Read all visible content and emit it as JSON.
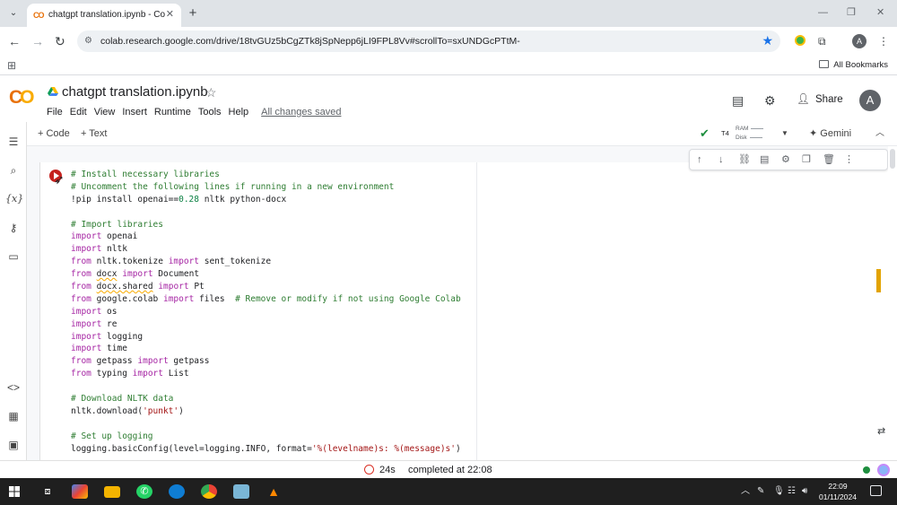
{
  "browser": {
    "tab": {
      "title": "chatgpt translation.ipynb - Cola",
      "favicon": "CO"
    },
    "url": "colab.research.google.com/drive/18tvGUz5bCgZTk8jSpNepp6jLI9FPL8Vv#scrollTo=sxUNDGcPTtM-",
    "bookmarks_label": "All Bookmarks",
    "profile_initial": "A"
  },
  "colab": {
    "logo": "CO",
    "title": "chatgpt translation.ipynb",
    "menu": [
      "File",
      "Edit",
      "View",
      "Insert",
      "Runtime",
      "Tools",
      "Help"
    ],
    "save_status": "All changes saved",
    "share_label": "Share",
    "avatar_initial": "A"
  },
  "toolbar": {
    "add_code": "Code",
    "add_text": "Text",
    "runtime_type": "T4",
    "ram_label": "RAM",
    "disk_label": "Disk",
    "gemini_label": "Gemini"
  },
  "cell": {
    "code_lines": [
      "# Install necessary libraries",
      "# Uncomment the following lines if running in a new environment",
      "!pip install openai==0.28 nltk python-docx",
      "",
      "# Import libraries",
      "import openai",
      "import nltk",
      "from nltk.tokenize import sent_tokenize",
      "from docx import Document",
      "from docx.shared import Pt",
      "from google.colab import files  # Remove or modify if not using Google Colab",
      "import os",
      "import re",
      "import logging",
      "import time",
      "from getpass import getpass",
      "from typing import List",
      "",
      "# Download NLTK data",
      "nltk.download('punkt')",
      "",
      "# Set up logging",
      "logging.basicConfig(level=logging.INFO, format='%(levelname)s: %(message)s')"
    ]
  },
  "status": {
    "elapsed": "24s",
    "message": "completed at 22:08"
  },
  "taskbar": {
    "time": "22:09",
    "date": "01/11/2024"
  }
}
